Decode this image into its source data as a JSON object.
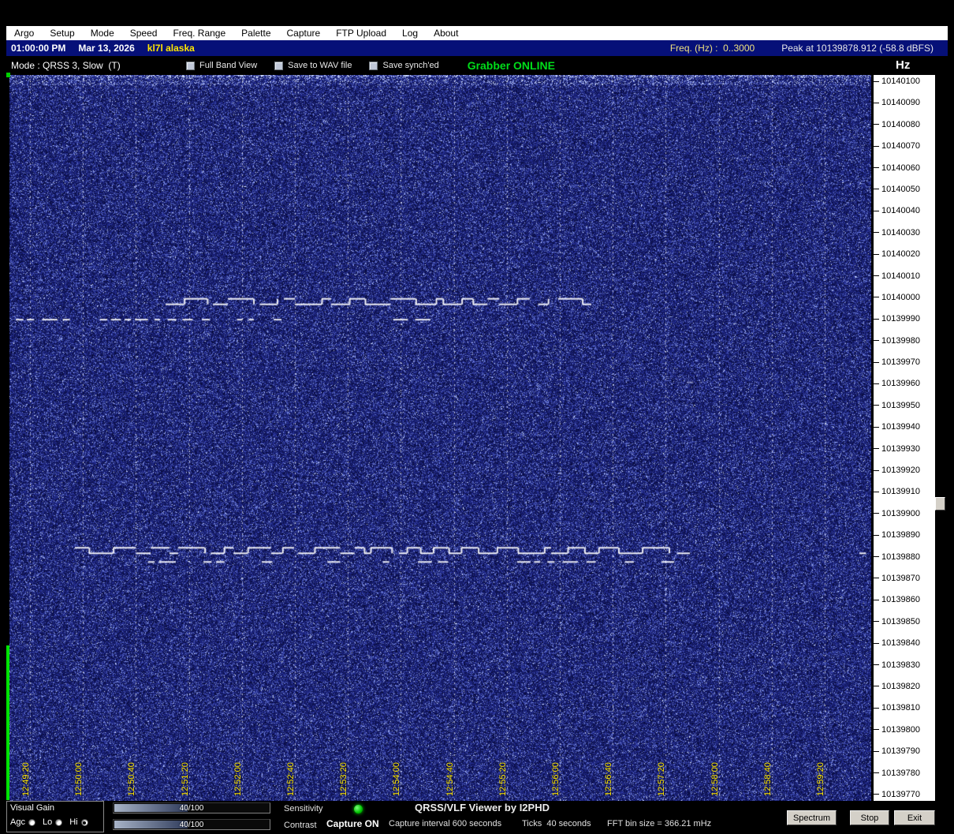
{
  "menu": {
    "items": [
      "Argo",
      "Setup",
      "Mode",
      "Speed",
      "Freq. Range",
      "Palette",
      "Capture",
      "FTP Upload",
      "Log",
      "About"
    ]
  },
  "status": {
    "time": "01:00:00 PM",
    "date": "Mar 13, 2026",
    "callsign": "kl7l alaska",
    "freq_range": "Freq. (Hz) :  0..3000",
    "peak": "Peak at 10139878.912 (-58.8 dBFS)"
  },
  "toolbar": {
    "mode": "Mode : QRSS 3, Slow  (T)",
    "checkboxes": [
      "Full Band View",
      "Save to WAV file",
      "Save synch'ed"
    ],
    "grabber": "Grabber ONLINE",
    "hz_unit": "Hz"
  },
  "waterfall": {
    "time_ticks": [
      "12:49:20",
      "12:50:00",
      "12:50:40",
      "12:51:20",
      "12:52:00",
      "12:52:40",
      "12:53:20",
      "12:54:00",
      "12:54:40",
      "12:55:20",
      "12:56:00",
      "12:56:40",
      "12:57:20",
      "12:58:00",
      "12:58:40",
      "12:59:20"
    ],
    "freq_scale": [
      "10140100",
      "10140090",
      "10140080",
      "10140070",
      "10140060",
      "10140050",
      "10140040",
      "10140030",
      "10140020",
      "10140010",
      "10140000",
      "10139990",
      "10139980",
      "10139970",
      "10139960",
      "10139950",
      "10139940",
      "10139930",
      "10139920",
      "10139910",
      "10139900",
      "10139890",
      "10139880",
      "10139870",
      "10139860",
      "10139850",
      "10139840",
      "10139830",
      "10139820",
      "10139810",
      "10139800",
      "10139790",
      "10139780",
      "10139770"
    ],
    "signals": [
      {
        "name": "upper-fsk-trace",
        "frequency_hz": 10140000
      },
      {
        "name": "upper-dash-trace",
        "frequency_hz": 10139990
      },
      {
        "name": "lower-fsk-trace",
        "frequency_hz": 10139882
      },
      {
        "name": "lower-dash-trace",
        "frequency_hz": 10139878
      },
      {
        "name": "faint-dash-trace",
        "frequency_hz": 10139961
      }
    ],
    "colors": {
      "noise_base": "#141e78",
      "signal": "#ffffff",
      "grid": "#ffffff",
      "time_label": "#ffe600"
    }
  },
  "bottom": {
    "visual_gain_label": "Visual Gain",
    "gain_options": [
      {
        "label": "Agc",
        "selected": false
      },
      {
        "label": "Lo",
        "selected": false
      },
      {
        "label": "Hi",
        "selected": true
      }
    ],
    "sensitivity_value": "40/100",
    "contrast_value": "40/100",
    "sensitivity_label": "Sensitivity",
    "contrast_label": "Contrast",
    "capture_status": "Capture ON",
    "app_title": "QRSS/VLF Viewer by I2PHD",
    "capture_interval": "Capture interval 600 seconds",
    "ticks_info": "Ticks  40 seconds",
    "fft_info": "FFT bin size = 366.21 mHz",
    "spectrum_button": "Spectrum",
    "stop_button": "Stop",
    "exit_button": "Exit"
  }
}
